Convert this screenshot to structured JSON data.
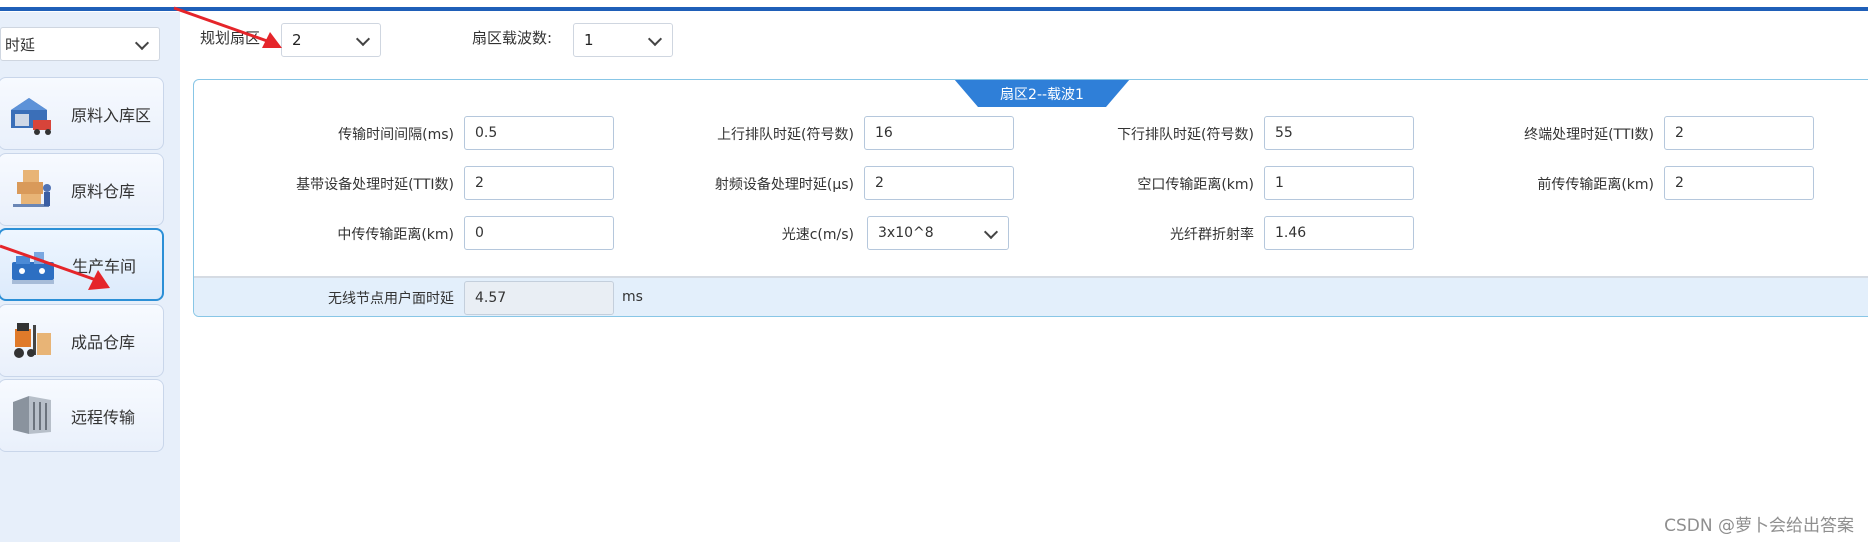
{
  "sidebar": {
    "mode_select": "时延",
    "items": [
      {
        "label": "原料入库区",
        "icon": "warehouse-truck-icon"
      },
      {
        "label": "原料仓库",
        "icon": "storage-rack-icon"
      },
      {
        "label": "生产车间",
        "icon": "production-machine-icon",
        "active": true
      },
      {
        "label": "成品仓库",
        "icon": "forklift-icon"
      },
      {
        "label": "远程传输",
        "icon": "server-rack-icon"
      }
    ]
  },
  "controls": {
    "sector_label": "规划扇区",
    "sector_value": "2",
    "carrier_label": "扇区载波数:",
    "carrier_value": "1"
  },
  "panel": {
    "tab_label": "扇区2--载波1",
    "fields": [
      {
        "label": "传输时间间隔(ms)",
        "value": "0.5"
      },
      {
        "label": "上行排队时延(符号数)",
        "value": "16"
      },
      {
        "label": "下行排队时延(符号数)",
        "value": "55"
      },
      {
        "label": "终端处理时延(TTI数)",
        "value": "2"
      },
      {
        "label": "基带设备处理时延(TTI数)",
        "value": "2"
      },
      {
        "label": "射频设备处理时延(μs)",
        "value": "2"
      },
      {
        "label": "空口传输距离(km)",
        "value": "1"
      },
      {
        "label": "前传传输距离(km)",
        "value": "2"
      },
      {
        "label": "中传传输距离(km)",
        "value": "0"
      },
      {
        "label": "光速c(m/s)",
        "value": "3x10^8"
      },
      {
        "label": "光纤群折射率",
        "value": "1.46"
      }
    ],
    "result": {
      "label": "无线节点用户面时延",
      "value": "4.57",
      "unit": "ms"
    }
  },
  "colors": {
    "accent": "#1f5fb8",
    "tab": "#2f7fd8",
    "arrow": "#e5252a"
  },
  "watermark": "CSDN @萝卜会给出答案"
}
